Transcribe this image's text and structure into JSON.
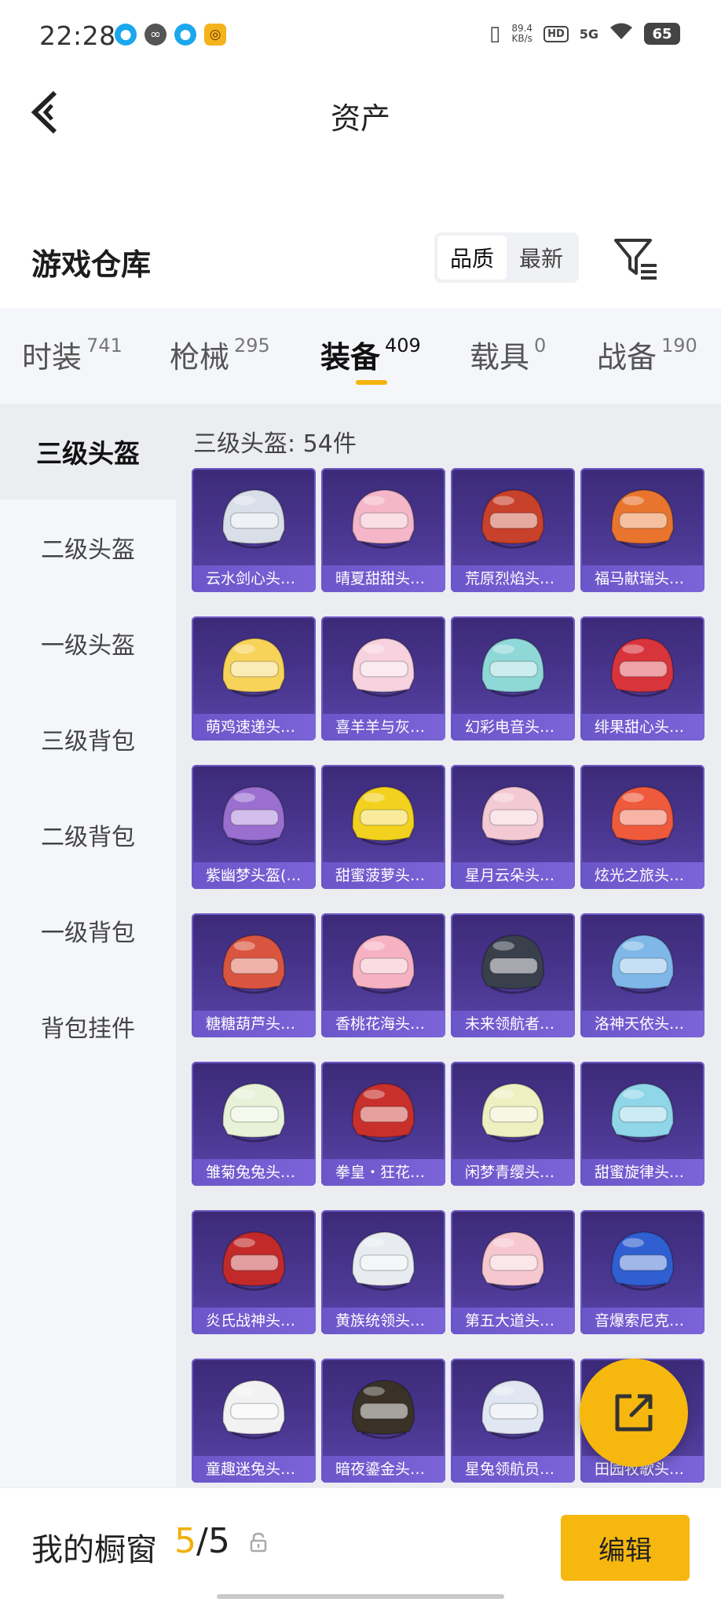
{
  "status_bar": {
    "time": "22:28",
    "net_speed_value": "89.4",
    "net_speed_unit": "KB/s",
    "hd": "HD",
    "network": "5G",
    "battery": "65"
  },
  "header": {
    "title": "资产"
  },
  "section": {
    "title": "游戏仓库",
    "sort_options": [
      "品质",
      "最新"
    ],
    "active_sort": "品质"
  },
  "categories": [
    {
      "label": "时装",
      "count": "741"
    },
    {
      "label": "枪械",
      "count": "295"
    },
    {
      "label": "装备",
      "count": "409"
    },
    {
      "label": "载具",
      "count": "0"
    },
    {
      "label": "战备",
      "count": "190"
    }
  ],
  "active_category": "装备",
  "sidebar": {
    "items": [
      "三级头盔",
      "二级头盔",
      "一级头盔",
      "三级背包",
      "二级背包",
      "一级背包",
      "背包挂件"
    ],
    "active": "三级头盔"
  },
  "content": {
    "count_label": "三级头盔: 54件",
    "items": [
      {
        "name": "云水剑心头…",
        "color": "#d9dfe8"
      },
      {
        "name": "晴夏甜甜头…",
        "color": "#f4b6c8"
      },
      {
        "name": "荒原烈焰头…",
        "color": "#c8412a"
      },
      {
        "name": "福马献瑞头…",
        "color": "#e8742e"
      },
      {
        "name": "萌鸡速递头…",
        "color": "#f7d35a"
      },
      {
        "name": "喜羊羊与灰…",
        "color": "#f7d2de"
      },
      {
        "name": "幻彩电音头…",
        "color": "#8fd8d8"
      },
      {
        "name": "绯果甜心头…",
        "color": "#d8343c"
      },
      {
        "name": "紫幽梦头盔(…",
        "color": "#9a6fd0"
      },
      {
        "name": "甜蜜菠萝头…",
        "color": "#f3d21f"
      },
      {
        "name": "星月云朵头…",
        "color": "#f3c9d4"
      },
      {
        "name": "炫光之旅头…",
        "color": "#ef5a3c"
      },
      {
        "name": "糖糖葫芦头…",
        "color": "#d9553f"
      },
      {
        "name": "香桃花海头…",
        "color": "#f6b2c2"
      },
      {
        "name": "未来领航者…",
        "color": "#3a3f4c"
      },
      {
        "name": "洛神天依头…",
        "color": "#7fb8e8"
      },
      {
        "name": "雏菊兔兔头…",
        "color": "#e8f2d8"
      },
      {
        "name": "拳皇・狂花…",
        "color": "#c8302c"
      },
      {
        "name": "闲梦青缨头…",
        "color": "#eef0c2"
      },
      {
        "name": "甜蜜旋律头…",
        "color": "#8fd6e8"
      },
      {
        "name": "炎氏战神头…",
        "color": "#c22a2a"
      },
      {
        "name": "黄族统领头…",
        "color": "#e8ecf0"
      },
      {
        "name": "第五大道头…",
        "color": "#f7c7cf"
      },
      {
        "name": "音爆索尼克…",
        "color": "#2f5fd0"
      },
      {
        "name": "童趣迷兔头…",
        "color": "#f2f2f2"
      },
      {
        "name": "暗夜鎏金头…",
        "color": "#3a3226"
      },
      {
        "name": "星兔领航员…",
        "color": "#e0e6f2"
      },
      {
        "name": "田园牧歌头…",
        "color": "#f3e4a8"
      }
    ]
  },
  "bottom_bar": {
    "showcase_label": "我的橱窗",
    "showcase_current": "5",
    "showcase_total": "/5",
    "edit_label": "编辑"
  },
  "colors": {
    "accent": "#f6b70f",
    "card_bg": "#4a3790",
    "card_label_bg": "#7060d0"
  }
}
